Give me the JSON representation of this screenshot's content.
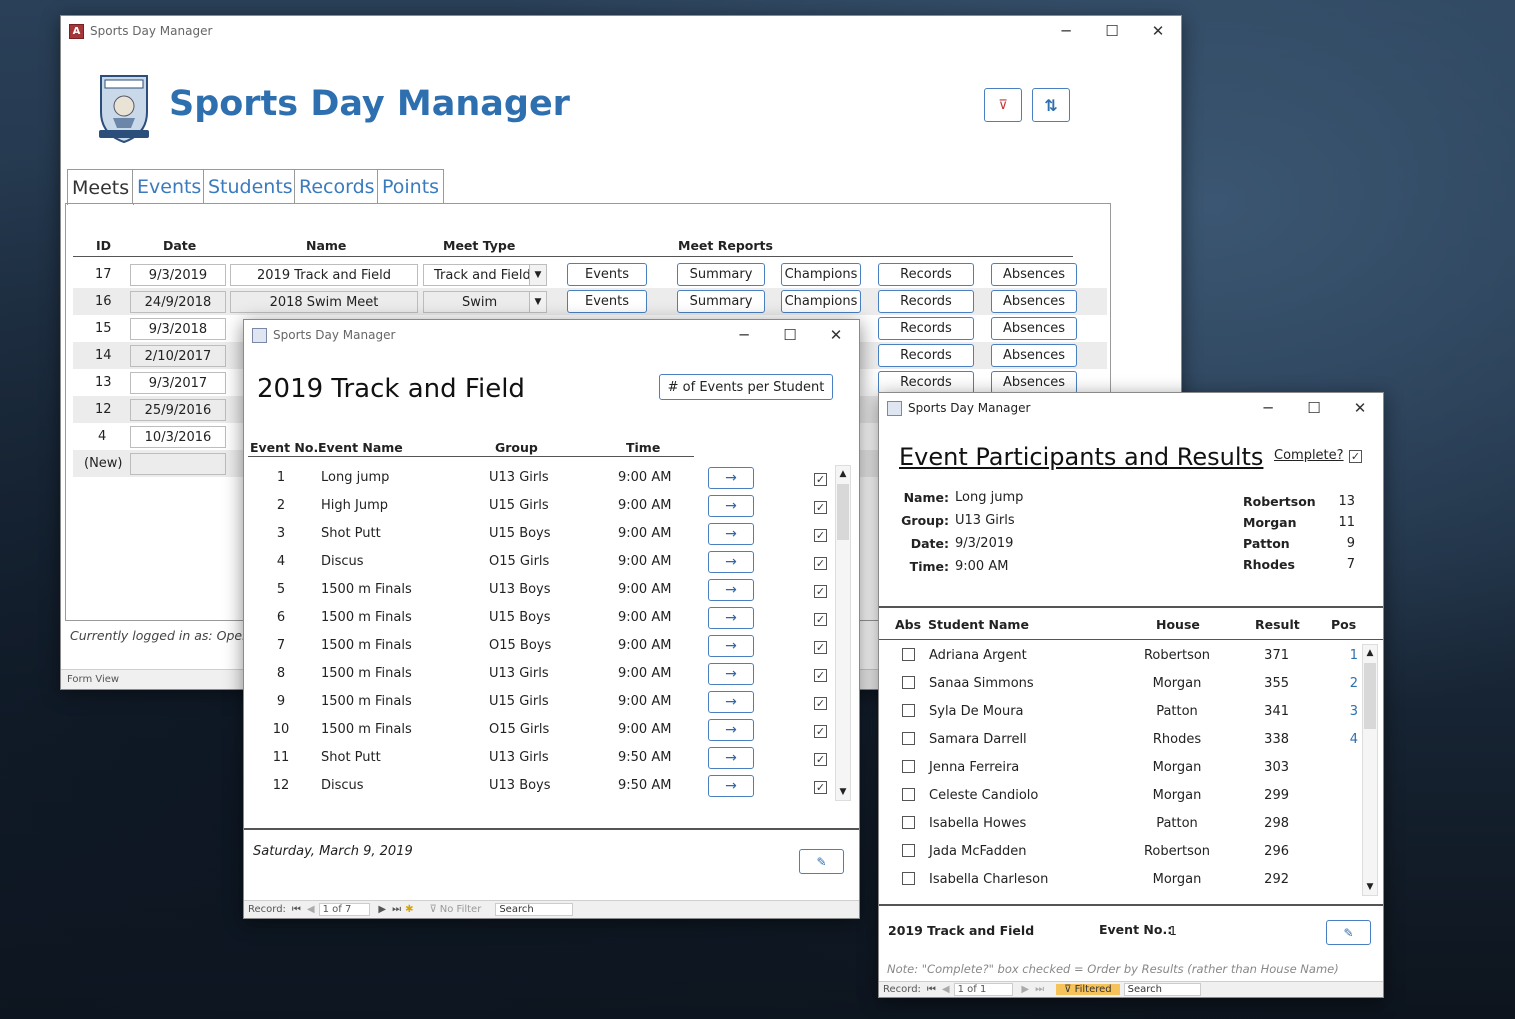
{
  "main": {
    "title": "Sports Day Manager",
    "app_icon": "A",
    "heading": "Sports Day Manager",
    "tabs": [
      "Meets",
      "Events",
      "Students",
      "Records",
      "Points"
    ],
    "headers": {
      "id": "ID",
      "date": "Date",
      "name": "Name",
      "type": "Meet Type",
      "reports": "Meet Reports"
    },
    "events_btn": "Events",
    "report_btns": [
      "Summary",
      "Champions",
      "Records",
      "Absences"
    ],
    "rows": [
      {
        "id": "17",
        "date": "9/3/2019",
        "name": "2019 Track and Field",
        "type": "Track and Field"
      },
      {
        "id": "16",
        "date": "24/9/2018",
        "name": "2018 Swim Meet",
        "type": "Swim"
      },
      {
        "id": "15",
        "date": "9/3/2018",
        "name": "",
        "type": ""
      },
      {
        "id": "14",
        "date": "2/10/2017",
        "name": "",
        "type": ""
      },
      {
        "id": "13",
        "date": "9/3/2017",
        "name": "",
        "type": ""
      },
      {
        "id": "12",
        "date": "25/9/2016",
        "name": "",
        "type": ""
      },
      {
        "id": "4",
        "date": "10/3/2016",
        "name": "",
        "type": ""
      }
    ],
    "new_row": "(New)",
    "logged_in": "Currently logged in as: Operat",
    "form_view": "Form View"
  },
  "meet": {
    "title": "Sports Day Manager",
    "heading": "2019 Track and Field",
    "events_per_student": "# of Events per Student",
    "headers": {
      "no": "Event No.",
      "name": "Event Name",
      "group": "Group",
      "time": "Time"
    },
    "arrow": "→",
    "check": "✓",
    "events": [
      {
        "no": "1",
        "name": "Long jump",
        "group": "U13 Girls",
        "time": "9:00 AM"
      },
      {
        "no": "2",
        "name": "High Jump",
        "group": "U15 Girls",
        "time": "9:00 AM"
      },
      {
        "no": "3",
        "name": "Shot Putt",
        "group": "U15 Boys",
        "time": "9:00 AM"
      },
      {
        "no": "4",
        "name": "Discus",
        "group": "O15 Girls",
        "time": "9:00 AM"
      },
      {
        "no": "5",
        "name": "1500 m Finals",
        "group": "U13 Boys",
        "time": "9:00 AM"
      },
      {
        "no": "6",
        "name": "1500 m Finals",
        "group": "U15 Boys",
        "time": "9:00 AM"
      },
      {
        "no": "7",
        "name": "1500 m Finals",
        "group": "O15 Boys",
        "time": "9:00 AM"
      },
      {
        "no": "8",
        "name": "1500 m Finals",
        "group": "U13 Girls",
        "time": "9:00 AM"
      },
      {
        "no": "9",
        "name": "1500 m Finals",
        "group": "U15 Girls",
        "time": "9:00 AM"
      },
      {
        "no": "10",
        "name": "1500 m Finals",
        "group": "O15 Girls",
        "time": "9:00 AM"
      },
      {
        "no": "11",
        "name": "Shot Putt",
        "group": "U13 Girls",
        "time": "9:50 AM"
      },
      {
        "no": "12",
        "name": "Discus",
        "group": "U13 Boys",
        "time": "9:50 AM"
      }
    ],
    "date_footer": "Saturday, March 9, 2019",
    "nav": {
      "record": "Record:",
      "pos": "1 of 7",
      "filter": "No Filter",
      "search": "Search"
    }
  },
  "results": {
    "title": "Sports Day Manager",
    "heading": "Event Participants and Results",
    "complete_label": "Complete?",
    "complete_checked": true,
    "info": [
      {
        "label": "Name:",
        "value": "Long jump"
      },
      {
        "label": "Group:",
        "value": "U13 Girls"
      },
      {
        "label": "Date:",
        "value": "9/3/2019"
      },
      {
        "label": "Time:",
        "value": "9:00 AM"
      }
    ],
    "houses": [
      {
        "name": "Robertson",
        "pts": "13"
      },
      {
        "name": "Morgan",
        "pts": "11"
      },
      {
        "name": "Patton",
        "pts": "9"
      },
      {
        "name": "Rhodes",
        "pts": "7"
      }
    ],
    "headers": {
      "abs": "Abs",
      "student": "Student Name",
      "house": "House",
      "result": "Result",
      "pos": "Pos"
    },
    "rows": [
      {
        "name": "Adriana Argent",
        "house": "Robertson",
        "result": "371",
        "pos": "1"
      },
      {
        "name": "Sanaa Simmons",
        "house": "Morgan",
        "result": "355",
        "pos": "2"
      },
      {
        "name": "Syla De Moura",
        "house": "Patton",
        "result": "341",
        "pos": "3"
      },
      {
        "name": "Samara Darrell",
        "house": "Rhodes",
        "result": "338",
        "pos": "4"
      },
      {
        "name": "Jenna Ferreira",
        "house": "Morgan",
        "result": "303",
        "pos": ""
      },
      {
        "name": "Celeste Candiolo",
        "house": "Morgan",
        "result": "299",
        "pos": ""
      },
      {
        "name": "Isabella Howes",
        "house": "Patton",
        "result": "298",
        "pos": ""
      },
      {
        "name": "Jada McFadden",
        "house": "Robertson",
        "result": "296",
        "pos": ""
      },
      {
        "name": "Isabella Charleson",
        "house": "Morgan",
        "result": "292",
        "pos": ""
      }
    ],
    "footer_meet": "2019 Track and Field",
    "footer_event_label": "Event No.:",
    "footer_event_value": "1",
    "note": "Note: \"Complete?\" box checked = Order by Results (rather than House Name)",
    "nav": {
      "record": "Record:",
      "pos": "1 of 1",
      "filter": "Filtered",
      "search": "Search"
    }
  }
}
